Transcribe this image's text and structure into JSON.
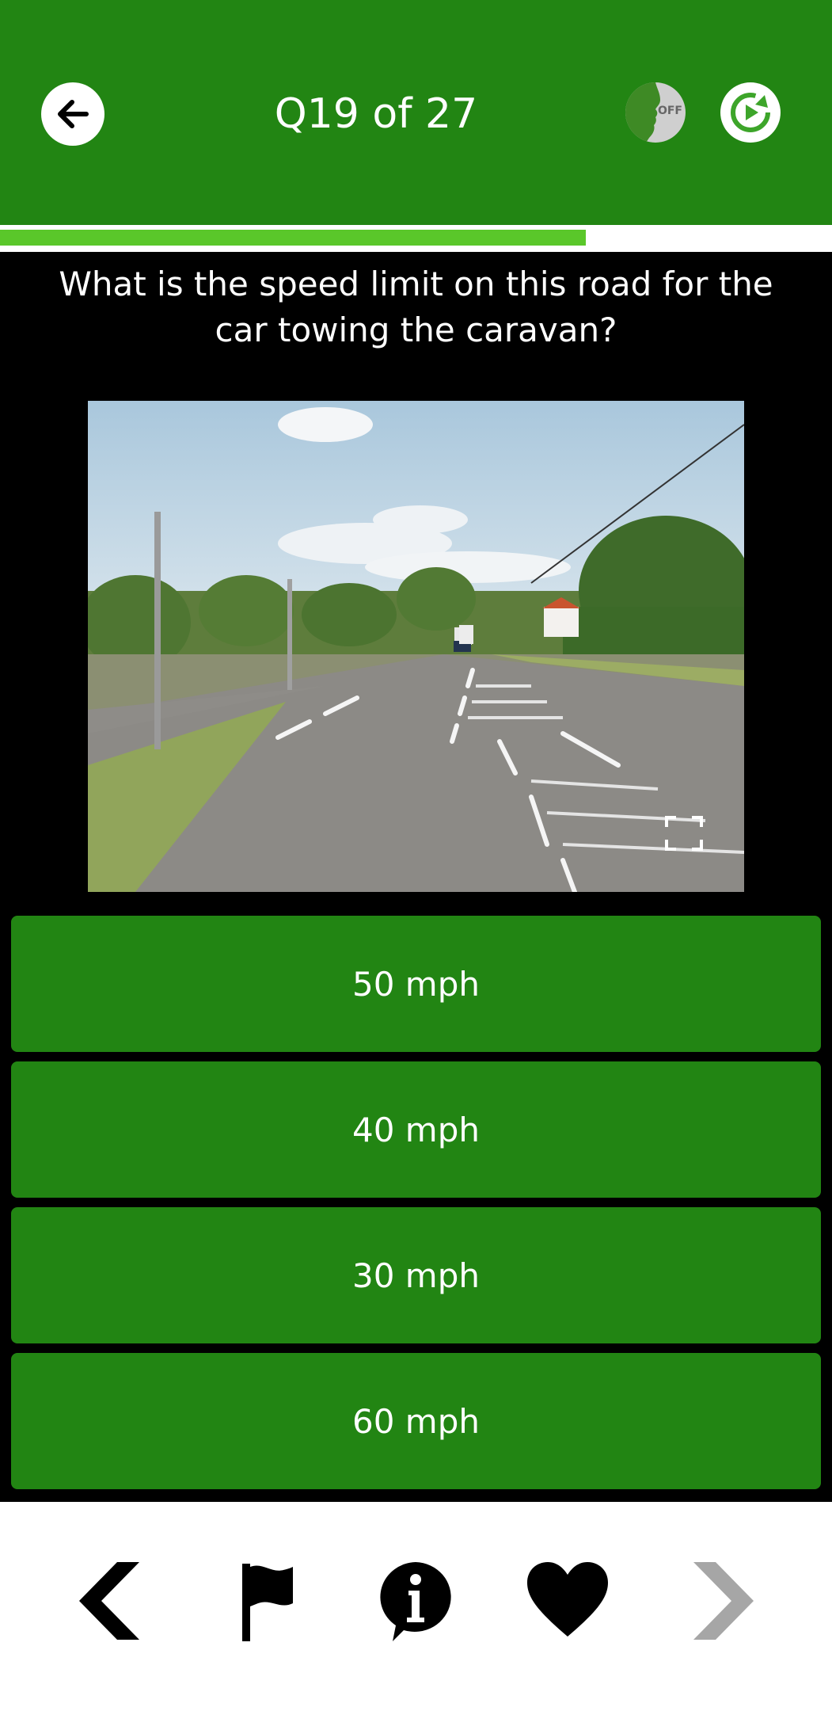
{
  "header": {
    "title": "Q19 of 27",
    "voice_toggle_label": "OFF",
    "bg_color": "#228513"
  },
  "progress": {
    "current": 19,
    "total": 27,
    "fraction": 0.704,
    "fill_color": "#5ac72a"
  },
  "question": {
    "text": "What is the speed limit on this road for the car towing the caravan?"
  },
  "image": {
    "description_icon": "fullscreen-icon"
  },
  "answers": [
    {
      "label": "50 mph"
    },
    {
      "label": "40 mph"
    },
    {
      "label": "30 mph"
    },
    {
      "label": "60 mph"
    }
  ],
  "bottom_nav": {
    "icons": [
      "previous-icon",
      "flag-icon",
      "info-icon",
      "favorite-icon",
      "next-icon"
    ]
  }
}
